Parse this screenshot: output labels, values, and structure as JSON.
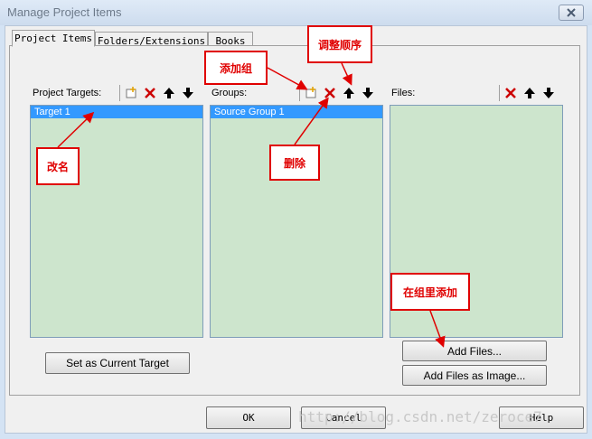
{
  "window": {
    "title": "Manage Project Items"
  },
  "tabs": [
    {
      "label": "Project Items",
      "active": true
    },
    {
      "label": "Folders/Extensions",
      "active": false
    },
    {
      "label": "Books",
      "active": false
    }
  ],
  "panels": {
    "targets": {
      "label": "Project Targets:",
      "items": [
        "Target 1"
      ]
    },
    "groups": {
      "label": "Groups:",
      "items": [
        "Source Group 1"
      ]
    },
    "files": {
      "label": "Files:",
      "items": []
    }
  },
  "buttons": {
    "set_current_target": "Set as Current Target",
    "add_files": "Add Files...",
    "add_files_image": "Add Files as Image...",
    "ok": "OK",
    "cancel": "Cancel",
    "help": "Help"
  },
  "annotations": {
    "add_group": "添加组",
    "reorder": "调整顺序",
    "rename": "改名",
    "delete": "删除",
    "add_in_group": "在组里添加"
  },
  "watermark": "http://blog.csdn.net/zeroce7",
  "icons": {
    "new": "new-item-icon",
    "delete": "delete-icon",
    "up": "move-up-icon",
    "down": "move-down-icon"
  },
  "colors": {
    "list_bg": "#cde5cd",
    "selection": "#3399ff",
    "annotation": "#e00000"
  }
}
